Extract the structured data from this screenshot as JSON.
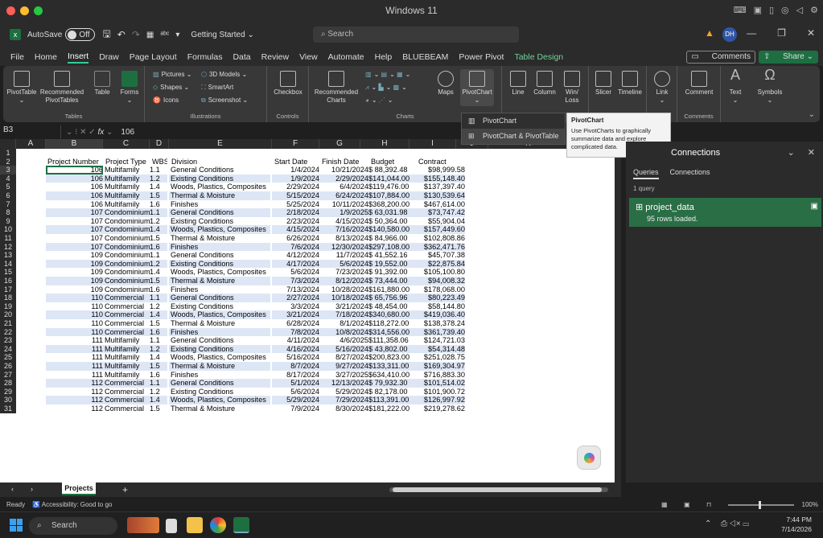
{
  "os": {
    "title": "Windows 11"
  },
  "app": {
    "autosave": "AutoSave",
    "autosave_state": "Off",
    "doc_title": "Getting Started",
    "search": "Search",
    "avatar": "DH"
  },
  "menu": {
    "items": [
      "File",
      "Home",
      "Insert",
      "Draw",
      "Page Layout",
      "Formulas",
      "Data",
      "Review",
      "View",
      "Automate",
      "Help",
      "BLUEBEAM",
      "Power Pivot",
      "Table Design"
    ],
    "comments": "Comments",
    "share": "Share"
  },
  "ribbon": {
    "pivottable": "PivotTable",
    "recommended_pivot": "Recommended PivotTables",
    "table": "Table",
    "forms": "Forms",
    "tables_group": "Tables",
    "pictures": "Pictures",
    "shapes": "Shapes",
    "icons": "Icons",
    "models3d": "3D Models",
    "smartart": "SmartArt",
    "screenshot": "Screenshot",
    "illustrations_group": "Illustrations",
    "checkbox": "Checkbox",
    "controls_group": "Controls",
    "rec_charts": "Recommended Charts",
    "maps": "Maps",
    "pivotchart": "PivotChart",
    "charts_group": "Charts",
    "line": "Line",
    "column": "Column",
    "winloss": "Win/ Loss",
    "slicer": "Slicer",
    "timeline": "Timeline",
    "link": "Link",
    "comment": "Comment",
    "comments_group": "Comments",
    "text": "Text",
    "symbols": "Symbols"
  },
  "popup": {
    "items": [
      "PivotChart",
      "PivotChart & PivotTable"
    ]
  },
  "tooltip": {
    "title": "PivotChart",
    "body": "Use PivotCharts to graphically summarize data and explore complicated data."
  },
  "formula": {
    "namebox": "B3",
    "fx": "fx",
    "value": "106"
  },
  "columns": [
    "A",
    "B",
    "C",
    "D",
    "E",
    "F",
    "G",
    "H",
    "I",
    "J",
    "K",
    "L"
  ],
  "headers": [
    "Project Number",
    "Project Type",
    "WBS",
    "Division",
    "Start Date",
    "Finish Date",
    "Budget",
    "Contract"
  ],
  "rows": [
    [
      "106",
      "Multifamily",
      "1.1",
      "General Conditions",
      "1/4/2024",
      "10/21/2024",
      "$ 88,392.48",
      "$98,999.58"
    ],
    [
      "106",
      "Multifamily",
      "1.2",
      "Existing Conditions",
      "1/9/2024",
      "2/29/2024",
      "$141,044.00",
      "$155,148.40"
    ],
    [
      "106",
      "Multifamily",
      "1.4",
      "Woods, Plastics, Composites",
      "2/29/2024",
      "6/4/2024",
      "$119,476.00",
      "$137,397.40"
    ],
    [
      "106",
      "Multifamily",
      "1.5",
      "Thermal & Moisture",
      "5/15/2024",
      "6/24/2024",
      "$107,884.00",
      "$130,539.64"
    ],
    [
      "106",
      "Multifamily",
      "1.6",
      "Finishes",
      "5/25/2024",
      "10/11/2024",
      "$368,200.00",
      "$467,614.00"
    ],
    [
      "107",
      "Condominium",
      "1.1",
      "General Conditions",
      "2/18/2024",
      "1/9/2025",
      "$ 63,031.98",
      "$73,747.42"
    ],
    [
      "107",
      "Condominium",
      "1.2",
      "Existing Conditions",
      "2/23/2024",
      "4/15/2024",
      "$ 50,364.00",
      "$55,904.04"
    ],
    [
      "107",
      "Condominium",
      "1.4",
      "Woods, Plastics, Composites",
      "4/15/2024",
      "7/16/2024",
      "$140,580.00",
      "$157,449.60"
    ],
    [
      "107",
      "Condominium",
      "1.5",
      "Thermal & Moisture",
      "6/26/2024",
      "8/13/2024",
      "$ 84,966.00",
      "$102,808.86"
    ],
    [
      "107",
      "Condominium",
      "1.6",
      "Finishes",
      "7/6/2024",
      "12/30/2024",
      "$297,108.00",
      "$362,471.76"
    ],
    [
      "109",
      "Condominium",
      "1.1",
      "General Conditions",
      "4/12/2024",
      "11/7/2024",
      "$ 41,552.16",
      "$45,707.38"
    ],
    [
      "109",
      "Condominium",
      "1.2",
      "Existing Conditions",
      "4/17/2024",
      "5/6/2024",
      "$ 19,552.00",
      "$22,875.84"
    ],
    [
      "109",
      "Condominium",
      "1.4",
      "Woods, Plastics, Composites",
      "5/6/2024",
      "7/23/2024",
      "$ 91,392.00",
      "$105,100.80"
    ],
    [
      "109",
      "Condominium",
      "1.5",
      "Thermal & Moisture",
      "7/3/2024",
      "8/12/2024",
      "$ 73,444.00",
      "$94,008.32"
    ],
    [
      "109",
      "Condominium",
      "1.6",
      "Finishes",
      "7/13/2024",
      "10/28/2024",
      "$161,880.00",
      "$178,068.00"
    ],
    [
      "110",
      "Commercial",
      "1.1",
      "General Conditions",
      "2/27/2024",
      "10/18/2024",
      "$ 65,756.96",
      "$80,223.49"
    ],
    [
      "110",
      "Commercial",
      "1.2",
      "Existing Conditions",
      "3/3/2024",
      "3/21/2024",
      "$ 48,454.00",
      "$58,144.80"
    ],
    [
      "110",
      "Commercial",
      "1.4",
      "Woods, Plastics, Composites",
      "3/21/2024",
      "7/18/2024",
      "$340,680.00",
      "$419,036.40"
    ],
    [
      "110",
      "Commercial",
      "1.5",
      "Thermal & Moisture",
      "6/28/2024",
      "8/1/2024",
      "$118,272.00",
      "$138,378.24"
    ],
    [
      "110",
      "Commercial",
      "1.6",
      "Finishes",
      "7/8/2024",
      "10/8/2024",
      "$314,556.00",
      "$361,739.40"
    ],
    [
      "111",
      "Multifamily",
      "1.1",
      "General Conditions",
      "4/11/2024",
      "4/6/2025",
      "$111,358.06",
      "$124,721.03"
    ],
    [
      "111",
      "Multifamily",
      "1.2",
      "Existing Conditions",
      "4/16/2024",
      "5/16/2024",
      "$ 43,802.00",
      "$54,314.48"
    ],
    [
      "111",
      "Multifamily",
      "1.4",
      "Woods, Plastics, Composites",
      "5/16/2024",
      "8/27/2024",
      "$200,823.00",
      "$251,028.75"
    ],
    [
      "111",
      "Multifamily",
      "1.5",
      "Thermal & Moisture",
      "8/7/2024",
      "9/27/2024",
      "$133,311.00",
      "$169,304.97"
    ],
    [
      "111",
      "Multifamily",
      "1.6",
      "Finishes",
      "8/17/2024",
      "3/27/2025",
      "$634,410.00",
      "$716,883.30"
    ],
    [
      "112",
      "Commercial",
      "1.1",
      "General Conditions",
      "5/1/2024",
      "12/13/2024",
      "$ 79,932.30",
      "$101,514.02"
    ],
    [
      "112",
      "Commercial",
      "1.2",
      "Existing Conditions",
      "5/6/2024",
      "5/29/2024",
      "$ 82,178.00",
      "$101,900.72"
    ],
    [
      "112",
      "Commercial",
      "1.4",
      "Woods, Plastics, Composites",
      "5/29/2024",
      "7/29/2024",
      "$113,391.00",
      "$126,997.92"
    ],
    [
      "112",
      "Commercial",
      "1.5",
      "Thermal & Moisture",
      "7/9/2024",
      "8/30/2024",
      "$181,222.00",
      "$219,278.62"
    ]
  ],
  "pane": {
    "title": "Connections",
    "tabs": [
      "Queries",
      "Connections"
    ],
    "count": "1 query",
    "query_name": "project_data",
    "query_status": "95 rows loaded."
  },
  "sheets": {
    "active": "Projects"
  },
  "status": {
    "ready": "Ready",
    "accessibility": "Accessibility: Good to go",
    "zoom": "100%"
  },
  "taskbar": {
    "search": "Search",
    "time": "7:44 PM",
    "date": "7/14/2026"
  }
}
